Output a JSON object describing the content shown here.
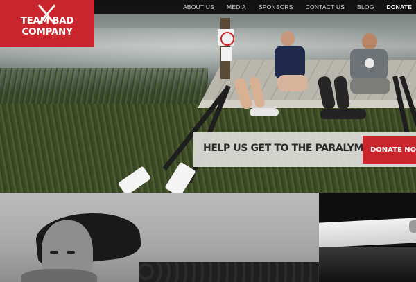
{
  "brand": {
    "name": "TEAM BAD COMPANY"
  },
  "nav": {
    "items": [
      {
        "label": "ABOUT US"
      },
      {
        "label": "MEDIA"
      },
      {
        "label": "SPONSORS"
      },
      {
        "label": "CONTACT US"
      },
      {
        "label": "BLOG"
      }
    ],
    "donate_label": "DONATE"
  },
  "hero": {
    "cta_text": "HELP US GET TO THE PARALYMPICS",
    "donate_button_label": "DONATE NOW"
  },
  "colors": {
    "accent_red": "#c8262c",
    "topbar": "#0a0a0a",
    "cta_background": "#deded a"
  }
}
